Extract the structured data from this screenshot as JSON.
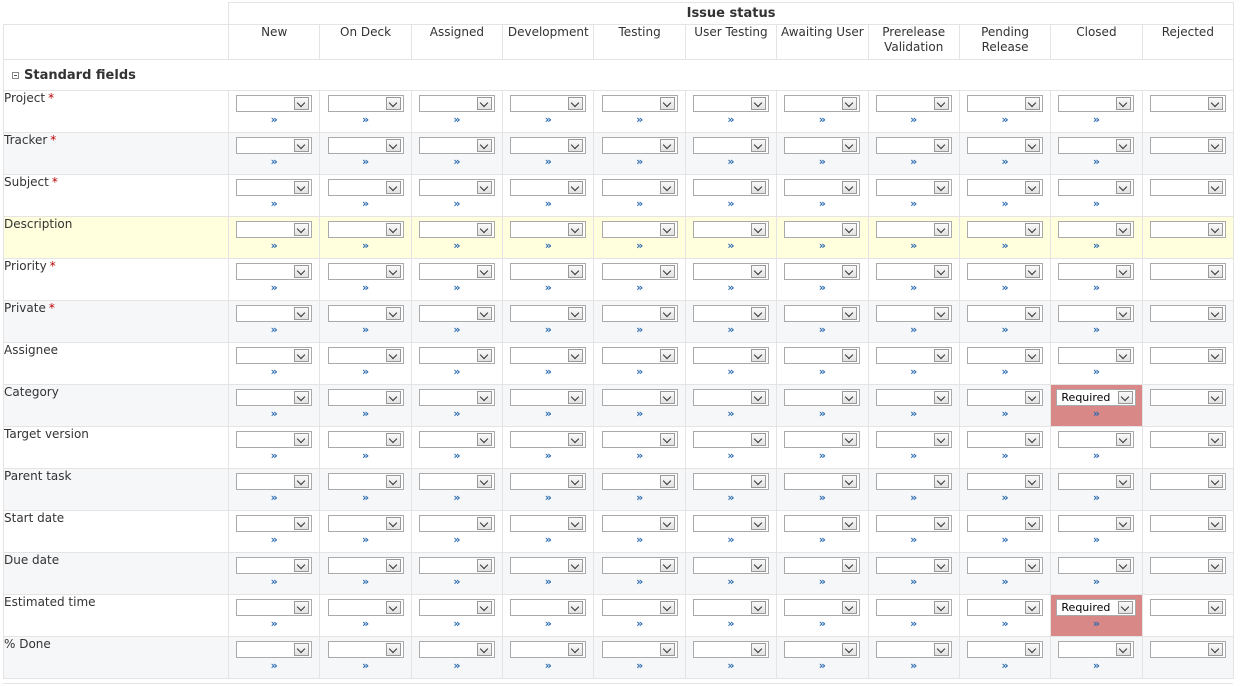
{
  "header": {
    "issue_status_label": "Issue status",
    "statuses": [
      "New",
      "On Deck",
      "Assigned",
      "Development",
      "Testing",
      "User Testing",
      "Awaiting User",
      "Prerelease Validation",
      "Pending Release",
      "Closed",
      "Rejected"
    ]
  },
  "group": {
    "title": "Standard fields"
  },
  "required_marker": "*",
  "expand_marker": "»",
  "fields": [
    {
      "label": "Project",
      "required": true
    },
    {
      "label": "Tracker",
      "required": true
    },
    {
      "label": "Subject",
      "required": true
    },
    {
      "label": "Description",
      "required": false,
      "highlight": true
    },
    {
      "label": "Priority",
      "required": true
    },
    {
      "label": "Private",
      "required": true
    },
    {
      "label": "Assignee",
      "required": false
    },
    {
      "label": "Category",
      "required": false,
      "overrides": {
        "Closed": "Required"
      }
    },
    {
      "label": "Target version",
      "required": false
    },
    {
      "label": "Parent task",
      "required": false
    },
    {
      "label": "Start date",
      "required": false
    },
    {
      "label": "Due date",
      "required": false
    },
    {
      "label": "Estimated time",
      "required": false,
      "overrides": {
        "Closed": "Required"
      }
    },
    {
      "label": "% Done",
      "required": false
    }
  ],
  "colors": {
    "required_cell_bg": "#d98888",
    "highlight_row_bg": "#ffffdd",
    "required_star": "#bb0000",
    "link": "#2a6ab0"
  }
}
